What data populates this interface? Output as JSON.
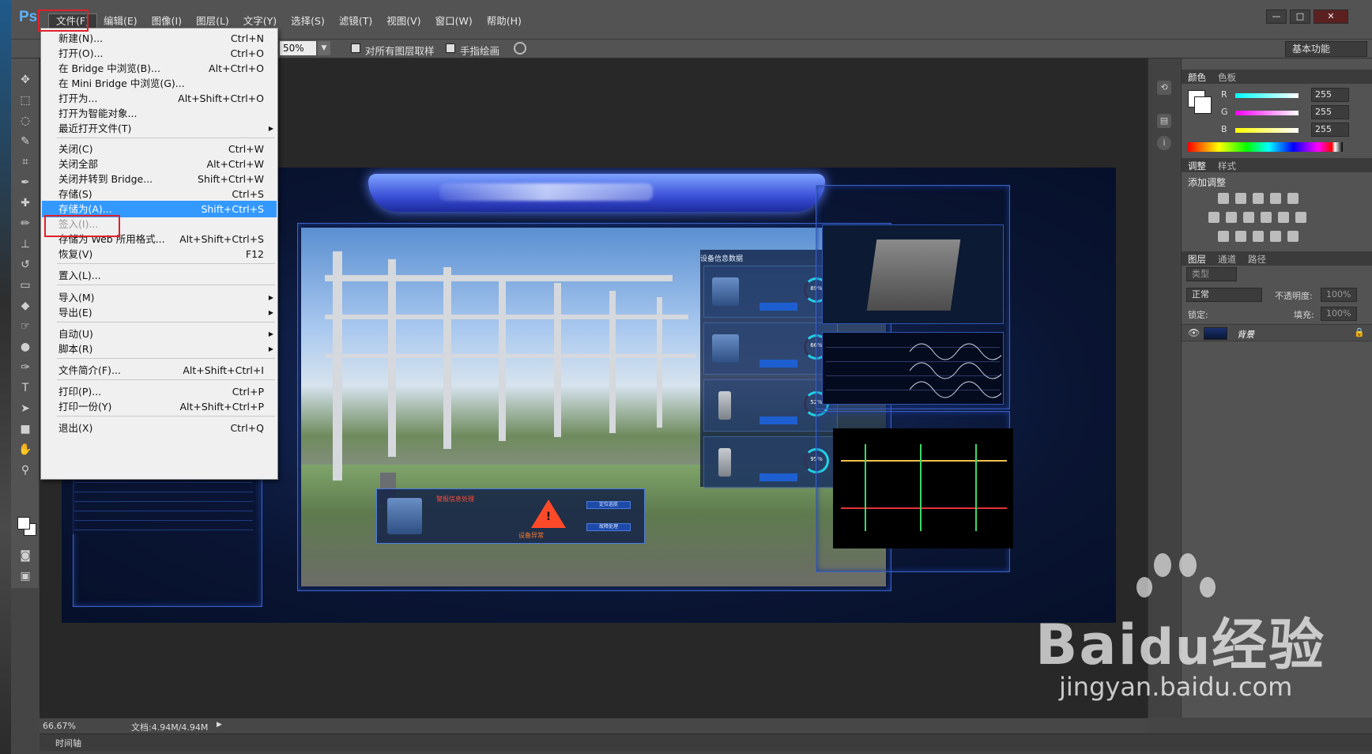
{
  "app": {
    "logo": "Ps",
    "menu": [
      "文件(F)",
      "编辑(E)",
      "图像(I)",
      "图层(L)",
      "文字(Y)",
      "选择(S)",
      "滤镜(T)",
      "视图(V)",
      "窗口(W)",
      "帮助(H)"
    ],
    "win_controls": {
      "minimize": "—",
      "maximize": "□",
      "close": "✕"
    }
  },
  "options_bar": {
    "zoom": "50%",
    "sample_all_layers": "对所有图层取样",
    "finger_paint": "手指绘画",
    "workspace": "基本功能"
  },
  "file_menu": {
    "items": [
      {
        "label": "新建(N)...",
        "shortcut": "Ctrl+N"
      },
      {
        "label": "打开(O)...",
        "shortcut": "Ctrl+O"
      },
      {
        "label": "在 Bridge 中浏览(B)...",
        "shortcut": "Alt+Ctrl+O"
      },
      {
        "label": "在 Mini Bridge 中浏览(G)...",
        "shortcut": ""
      },
      {
        "label": "打开为...",
        "shortcut": "Alt+Shift+Ctrl+O"
      },
      {
        "label": "打开为智能对象...",
        "shortcut": ""
      },
      {
        "label": "最近打开文件(T)",
        "shortcut": "",
        "submenu": true
      },
      {
        "label": "关闭(C)",
        "shortcut": "Ctrl+W"
      },
      {
        "label": "关闭全部",
        "shortcut": "Alt+Ctrl+W"
      },
      {
        "label": "关闭并转到 Bridge...",
        "shortcut": "Shift+Ctrl+W"
      },
      {
        "label": "存储(S)",
        "shortcut": "Ctrl+S"
      },
      {
        "label": "存储为(A)...",
        "shortcut": "Shift+Ctrl+S",
        "highlight": true
      },
      {
        "label": "签入(I)...",
        "shortcut": "",
        "disabled": true
      },
      {
        "label": "存储为 Web 所用格式...",
        "shortcut": "Alt+Shift+Ctrl+S"
      },
      {
        "label": "恢复(V)",
        "shortcut": "F12"
      },
      {
        "label": "置入(L)...",
        "shortcut": ""
      },
      {
        "label": "导入(M)",
        "shortcut": "",
        "submenu": true
      },
      {
        "label": "导出(E)",
        "shortcut": "",
        "submenu": true
      },
      {
        "label": "自动(U)",
        "shortcut": "",
        "submenu": true
      },
      {
        "label": "脚本(R)",
        "shortcut": "",
        "submenu": true
      },
      {
        "label": "文件简介(F)...",
        "shortcut": "Alt+Shift+Ctrl+I"
      },
      {
        "label": "打印(P)...",
        "shortcut": "Ctrl+P"
      },
      {
        "label": "打印一份(Y)",
        "shortcut": "Alt+Shift+Ctrl+P"
      },
      {
        "label": "退出(X)",
        "shortcut": "Ctrl+Q"
      }
    ]
  },
  "canvas": {
    "device_panel_title": "设备信息数据",
    "device_cards": [
      {
        "pct": "89%"
      },
      {
        "pct": "66%"
      },
      {
        "pct": "52%"
      },
      {
        "pct": "95%"
      }
    ],
    "alarm_title": "警报信息处理",
    "alarm_label": "设备异常",
    "alarm_btn1": "定位巡航",
    "alarm_btn2": "故障处理"
  },
  "color_panel": {
    "tabs": [
      "颜色",
      "色板"
    ],
    "channels": [
      {
        "label": "R",
        "value": "255"
      },
      {
        "label": "G",
        "value": "255"
      },
      {
        "label": "B",
        "value": "255"
      }
    ]
  },
  "adjust_panel": {
    "tabs": [
      "调整",
      "样式"
    ],
    "title": "添加调整"
  },
  "layers_panel": {
    "tabs": [
      "图层",
      "通道",
      "路径"
    ],
    "filter": "类型",
    "blend_mode": "正常",
    "opacity_label": "不透明度:",
    "opacity": "100%",
    "lock_label": "锁定:",
    "fill_label": "填充:",
    "fill": "100%",
    "layer_name": "背景"
  },
  "status_bar": {
    "zoom": "66.67%",
    "doc_info": "文档:4.94M/4.94M",
    "timeline": "时间轴"
  },
  "watermark": {
    "brand": "Bai",
    "brand2": "经验",
    "url": "jingyan.baidu.com"
  }
}
